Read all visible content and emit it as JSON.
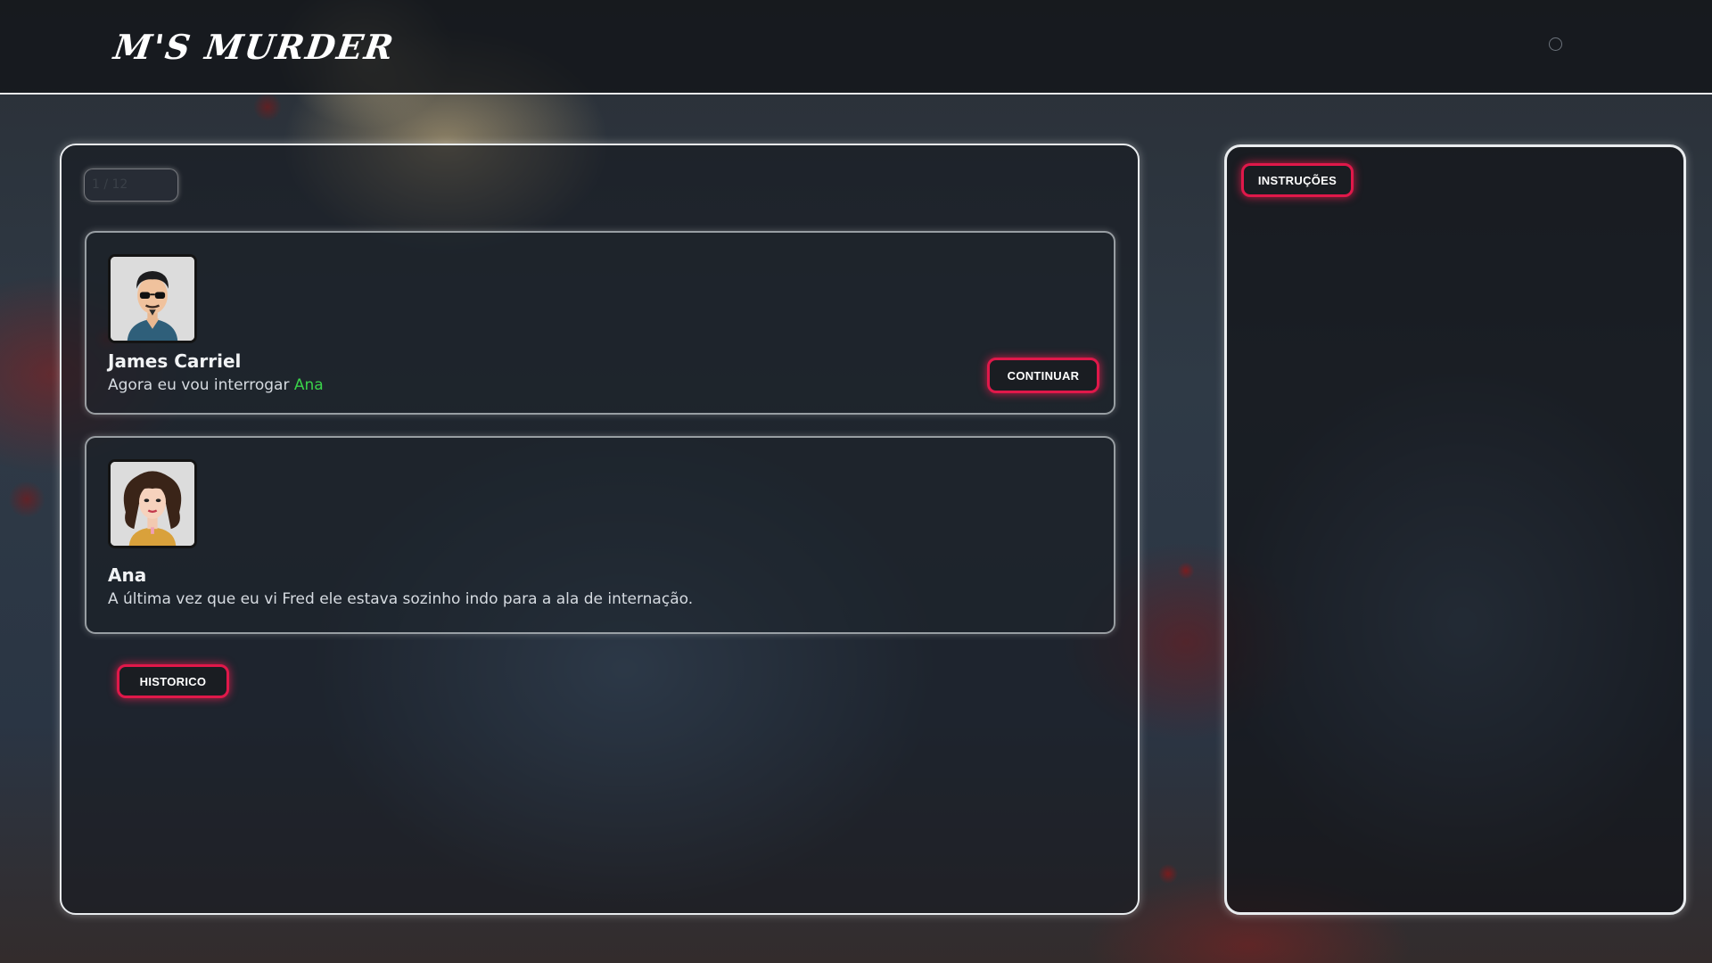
{
  "header": {
    "logo": "M'S MURDER"
  },
  "game": {
    "counter": "1 / 12",
    "dialogs": [
      {
        "speaker": "James Carriel",
        "text_before": "Agora eu vou interrogar ",
        "highlight": "Ana",
        "text_after": "",
        "avatar": "male-detective-avatar"
      },
      {
        "speaker": "Ana",
        "text_before": "A última vez que eu vi Fred ele estava sozinho indo para a ala de internação.",
        "highlight": "",
        "text_after": "",
        "avatar": "female-curly-hair-avatar"
      }
    ],
    "continue_label": "CONTINUAR",
    "history_label": "HISTORICO"
  },
  "sidebar": {
    "instructions_label": "INSTRUÇÕES"
  },
  "colors": {
    "accent_glow": "#e0184a",
    "highlight_name": "#3ad24a",
    "panel_border": "#e9ecef"
  }
}
